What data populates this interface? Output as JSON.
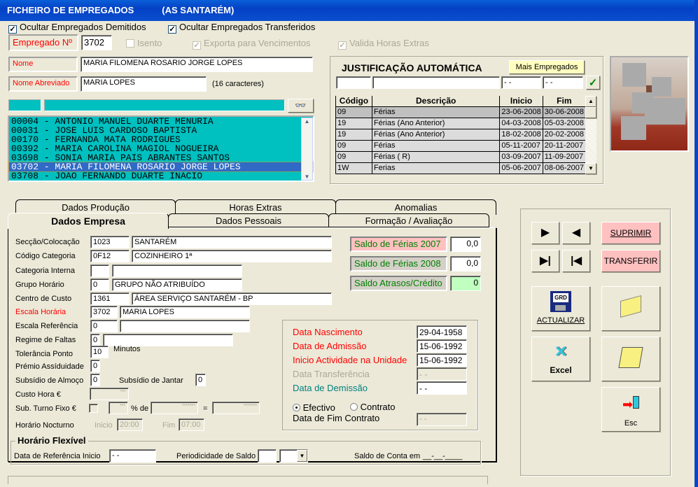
{
  "window": {
    "title": "FICHEIRO DE EMPREGADOS",
    "subtitle": "(AS SANTARÉM)"
  },
  "options": {
    "hide_dismissed": "Ocultar Empregados Demitidos",
    "hide_transferred": "Ocultar Empregados Transferidos",
    "isento": "Isento",
    "exporta": "Exporta para Vencimentos",
    "valida": "Valida Horas Extras"
  },
  "employee": {
    "number_label": "Empregado Nº",
    "number": "3702",
    "name_label": "Nome",
    "name": "MARIA FILOMENA ROSARIO JORGE LOPES",
    "short_label": "Nome Abreviado",
    "short": "MARIA LOPES",
    "short_hint": "(16 caracteres)"
  },
  "employee_list": [
    "00004 - ANTONIO MANUEL DUARTE MENURIA",
    "00031 - JOSE LUIS CARDOSO BAPTISTA",
    "00170 - FERNANDA MATA RODRIGUES",
    "00392 - MARIA CAROLINA MAGIOL NOGUEIRA",
    "03698 - SONIA MARIA PAIS ABRANTES SANTOS",
    "03702 - MARIA FILOMENA ROSARIO JORGE LOPES",
    "03708 - JOAO FERNANDO DUARTE INACIO"
  ],
  "justificacao": {
    "title": "JUSTIFICAÇÃO AUTOMÁTICA",
    "more_button": "Mais Empregados",
    "date_placeholder": "- -",
    "headers": [
      "Código",
      "Descrição",
      "Inicio",
      "Fim"
    ],
    "rows": [
      [
        "09",
        "Férias",
        "23-06-2008",
        "30-06-2008"
      ],
      [
        "19",
        "Férias (Ano Anterior)",
        "04-03-2008",
        "05-03-2008"
      ],
      [
        "19",
        "Férias (Ano Anterior)",
        "18-02-2008",
        "20-02-2008"
      ],
      [
        "09",
        "Férias",
        "05-11-2007",
        "20-11-2007"
      ],
      [
        "09",
        "Férias  ( R)",
        "03-09-2007",
        "11-09-2007"
      ],
      [
        "1W",
        "Ferias",
        "05-06-2007",
        "08-06-2007"
      ]
    ]
  },
  "tabs": {
    "back": [
      "Dados Produção",
      "Horas Extras",
      "Anomalias"
    ],
    "front": [
      "Dados Empresa",
      "Dados Pessoais",
      "Formação / Avaliação"
    ],
    "active": "Dados Empresa"
  },
  "empresa": {
    "seccao": {
      "label": "Secção/Colocação",
      "code": "1023",
      "desc": "SANTARÉM"
    },
    "categoria": {
      "label": "Código Categoria",
      "code": "0F12",
      "desc": "COZINHEIRO 1ª"
    },
    "cat_interna": {
      "label": "Categoria Interna",
      "code": "",
      "desc": ""
    },
    "grupo": {
      "label": "Grupo Horário",
      "code": "0",
      "desc": "GRUPO NÃO ATRIBUÍDO"
    },
    "centro": {
      "label": "Centro de Custo",
      "code": "1361",
      "desc": "ÁREA SERVIÇO SANTARÉM - BP"
    },
    "escala": {
      "label": "Escala Horária",
      "code": "3702",
      "desc": "MARIA LOPES"
    },
    "escala_ref": {
      "label": "Escala Referência",
      "code": "0",
      "desc": ""
    },
    "regime": {
      "label": "Regime de Faltas",
      "code": "0",
      "desc": ""
    },
    "tolerancia": {
      "label": "Tolerância Ponto",
      "value": "10",
      "unit": "Minutos"
    },
    "premio": {
      "label": "Prémio Assíduidade",
      "value": "0"
    },
    "almoco": {
      "label": "Subsídio de Almoço",
      "value": "0"
    },
    "jantar": {
      "label": "Subsídio de Jantar",
      "value": "0"
    },
    "custo": {
      "label": "Custo Hora €",
      "value": "***"
    },
    "turno": {
      "label": "Sub. Turno Fixo €",
      "pct": "***",
      "pct_label": "% de",
      "base": "*******",
      "eq": "=",
      "result": "*******"
    },
    "nocturno": {
      "label": "Horário Nocturno",
      "inicio_label": "Inicio",
      "inicio": "20:00",
      "fim_label": "Fim",
      "fim": "07:00"
    }
  },
  "saldos": [
    {
      "label": "Saldo de Férias 2007",
      "value": "0,0"
    },
    {
      "label": "Saldo de Férias 2008",
      "value": "0,0"
    },
    {
      "label": "Saldo Atrasos/Crédito",
      "value": "0"
    }
  ],
  "datas": {
    "nascimento": {
      "label": "Data Nascimento",
      "value": "29-04-1958"
    },
    "admissao": {
      "label": "Data de Admissão",
      "value": "15-06-1992"
    },
    "inicio": {
      "label": "Inicio Actividade na Unidade",
      "value": "15-06-1992"
    },
    "transferencia": {
      "label": "Data Transferência",
      "value": "- -"
    },
    "demissao": {
      "label": "Data de Demissão",
      "value": "- -"
    },
    "efectivo": "Efectivo",
    "contrato": "Contrato",
    "fim_contrato": {
      "label": "Data de Fim Contrato",
      "value": "- -"
    }
  },
  "flexivel": {
    "title": "Horário Flexível",
    "ref_label": "Data de Referência Inicio",
    "ref_value": "- -",
    "period_label": "Periodicidade de Saldo",
    "saldo_label": "Saldo de Conta em",
    "saldo_value": "__-__-____"
  },
  "buttons": {
    "suprimir": "SUPRIMIR",
    "transferir": "TRANSFERIR",
    "actualizar": "ACTUALIZAR",
    "excel": "Excel",
    "esc": "Esc"
  },
  "colors": {
    "title_bar": "#0441c4",
    "list_bg": "#00c0c0",
    "selection": "#316ac5",
    "pink_button": "#ffc0c0",
    "yellow_button": "#ffffc0"
  }
}
